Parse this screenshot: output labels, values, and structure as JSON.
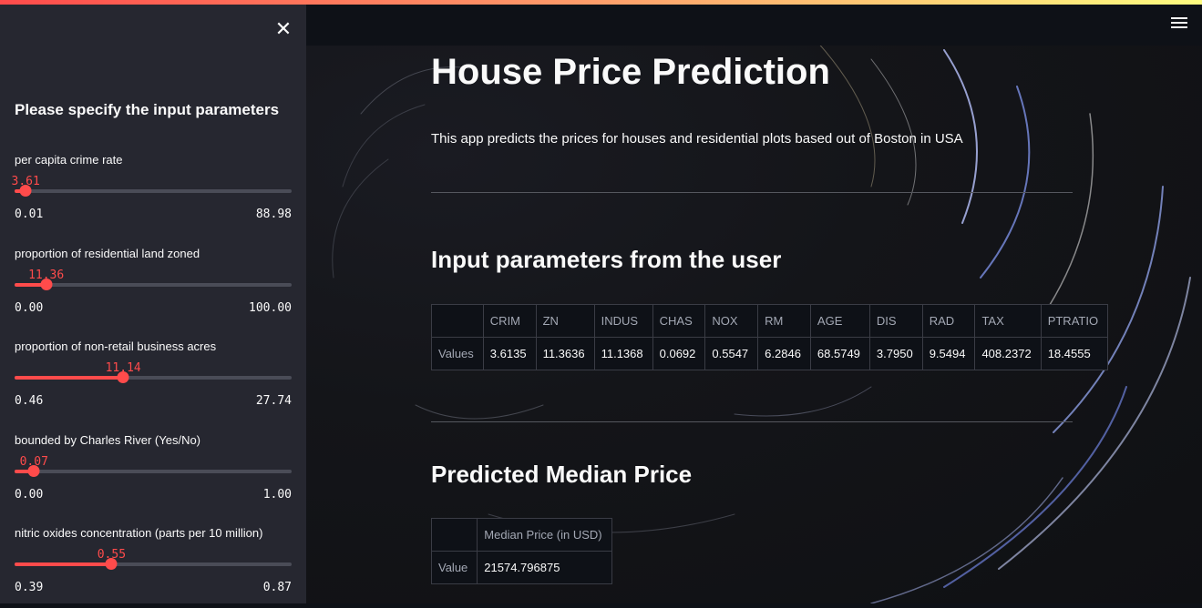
{
  "sidebar": {
    "title": "Please specify the input parameters",
    "sliders": [
      {
        "label": "per capita crime rate",
        "value": "3.61",
        "min": "0.01",
        "max": "88.98",
        "fraction": 0.04
      },
      {
        "label": "proportion of residential land zoned",
        "value": "11.36",
        "min": "0.00",
        "max": "100.00",
        "fraction": 0.114
      },
      {
        "label": "proportion of non-retail business acres",
        "value": "11.14",
        "min": "0.46",
        "max": "27.74",
        "fraction": 0.392
      },
      {
        "label": "bounded by Charles River (Yes/No)",
        "value": "0.07",
        "min": "0.00",
        "max": "1.00",
        "fraction": 0.07
      },
      {
        "label": "nitric oxides concentration (parts per 10 million)",
        "value": "0.55",
        "min": "0.39",
        "max": "0.87",
        "fraction": 0.35
      }
    ]
  },
  "main": {
    "title": "House Price Prediction",
    "description": "This app predicts the prices for houses and residential plots based out of Boston in USA",
    "input_heading": "Input parameters from the user",
    "input_table": {
      "columns": [
        "CRIM",
        "ZN",
        "INDUS",
        "CHAS",
        "NOX",
        "RM",
        "AGE",
        "DIS",
        "RAD",
        "TAX",
        "PTRATIO"
      ],
      "row_label": "Values",
      "values": [
        "3.6135",
        "11.3636",
        "11.1368",
        "0.0692",
        "0.5547",
        "6.2846",
        "68.5749",
        "3.7950",
        "9.5494",
        "408.2372",
        "18.4555"
      ]
    },
    "prediction_heading": "Predicted Median Price",
    "prediction_table": {
      "column": "Median Price (in USD)",
      "row_label": "Value",
      "value": "21574.796875"
    }
  },
  "icons": {
    "close": "close-icon",
    "menu": "hamburger-menu-icon"
  },
  "colors": {
    "accent": "#ff4b4b",
    "sidebar_bg": "#262730",
    "app_bg": "#0e1117"
  }
}
